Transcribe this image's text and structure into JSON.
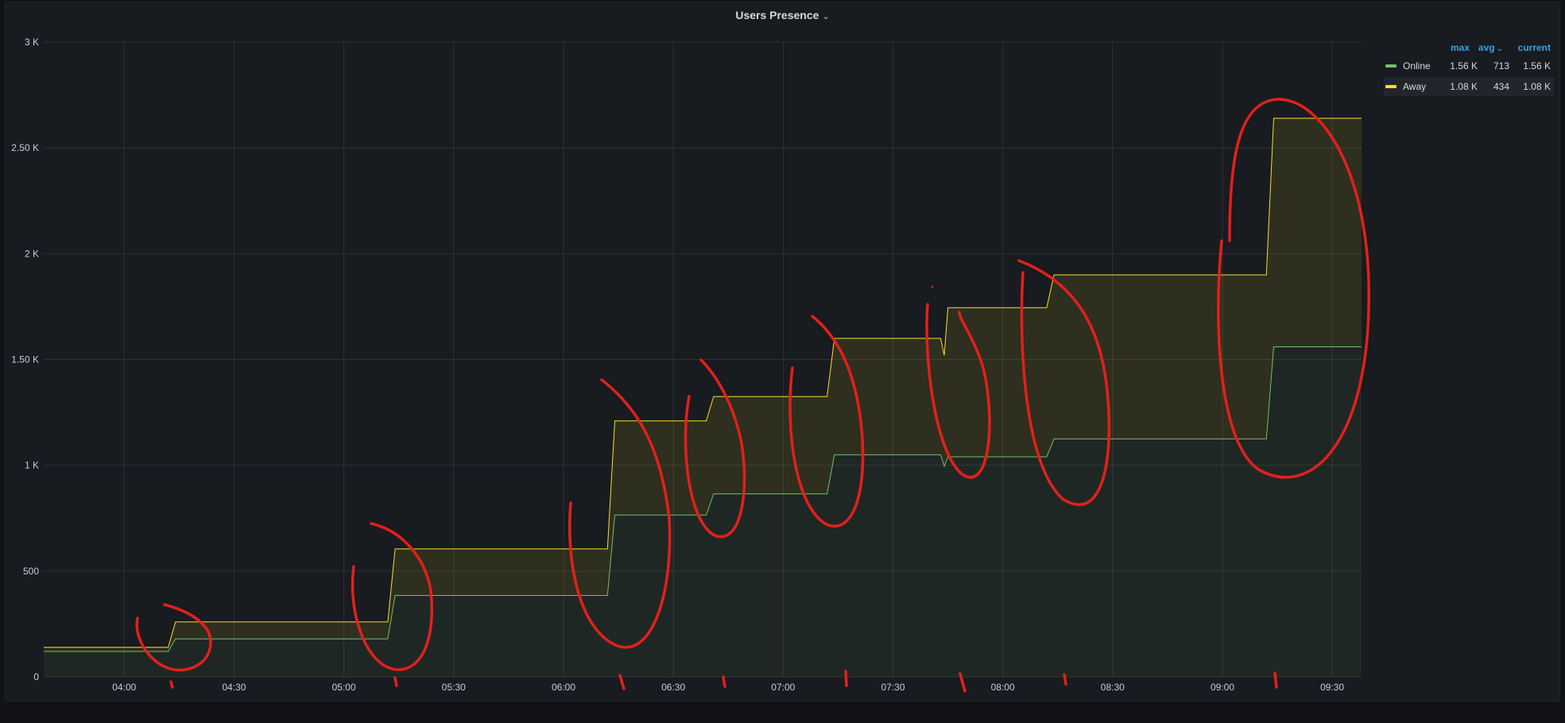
{
  "panel": {
    "title": "Users Presence"
  },
  "legend": {
    "headers": {
      "max": "max",
      "avg": "avg",
      "current": "current"
    },
    "series": [
      {
        "name": "Online",
        "max": "1.56 K",
        "avg": "713",
        "current": "1.56 K",
        "color": "#73bf69"
      },
      {
        "name": "Away",
        "max": "1.08 K",
        "avg": "434",
        "current": "1.08 K",
        "color": "#fade2a"
      }
    ]
  },
  "chart_data": {
    "type": "area",
    "stacked": true,
    "title": "Users Presence",
    "x_ticks": [
      "04:00",
      "04:30",
      "05:00",
      "05:30",
      "06:00",
      "06:30",
      "07:00",
      "07:30",
      "08:00",
      "08:30",
      "09:00",
      "09:30"
    ],
    "y_ticks": [
      "0",
      "500",
      "1 K",
      "1.50 K",
      "2 K",
      "2.50 K",
      "3 K"
    ],
    "y_tick_values": [
      0,
      500,
      1000,
      1500,
      2000,
      2500,
      3000
    ],
    "xlim": [
      "03:38",
      "09:38"
    ],
    "ylim": [
      0,
      3000
    ],
    "grid": true,
    "legend_position": "right",
    "series": [
      {
        "name": "Online",
        "color": "#73bf69",
        "points": [
          [
            "03:38",
            120
          ],
          [
            "04:12",
            120
          ],
          [
            "04:14",
            180
          ],
          [
            "05:12",
            180
          ],
          [
            "05:14",
            385
          ],
          [
            "06:12",
            385
          ],
          [
            "06:14",
            765
          ],
          [
            "06:39",
            765
          ],
          [
            "06:41",
            865
          ],
          [
            "07:12",
            865
          ],
          [
            "07:14",
            1050
          ],
          [
            "07:43",
            1050
          ],
          [
            "07:44",
            995
          ],
          [
            "07:45",
            1040
          ],
          [
            "08:12",
            1040
          ],
          [
            "08:14",
            1125
          ],
          [
            "09:12",
            1125
          ],
          [
            "09:14",
            1560
          ],
          [
            "09:38",
            1560
          ]
        ]
      },
      {
        "name": "Away",
        "color": "#fade2a",
        "points": [
          [
            "03:38",
            20
          ],
          [
            "04:12",
            20
          ],
          [
            "04:14",
            80
          ],
          [
            "05:12",
            80
          ],
          [
            "05:14",
            220
          ],
          [
            "06:12",
            220
          ],
          [
            "06:14",
            445
          ],
          [
            "06:39",
            445
          ],
          [
            "06:41",
            460
          ],
          [
            "07:12",
            460
          ],
          [
            "07:14",
            550
          ],
          [
            "07:43",
            550
          ],
          [
            "07:44",
            525
          ],
          [
            "07:45",
            705
          ],
          [
            "08:12",
            705
          ],
          [
            "08:14",
            775
          ],
          [
            "09:12",
            775
          ],
          [
            "09:14",
            1080
          ],
          [
            "09:38",
            1080
          ]
        ]
      }
    ]
  }
}
